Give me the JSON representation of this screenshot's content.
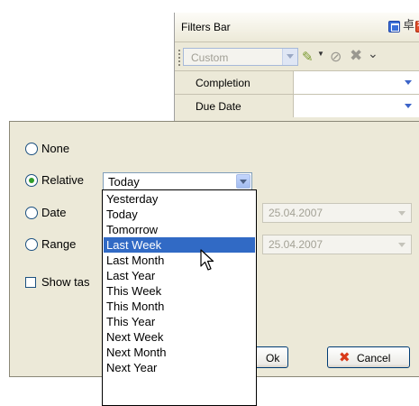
{
  "panel": {
    "title": "Filters Bar",
    "toolbar": {
      "preset_value": "Custom"
    },
    "rows": [
      {
        "label": "Completion"
      },
      {
        "label": "Due Date"
      }
    ]
  },
  "dialog": {
    "options": [
      {
        "label": "None",
        "selected": false
      },
      {
        "label": "Relative",
        "selected": true
      },
      {
        "label": "Date",
        "selected": false
      },
      {
        "label": "Range",
        "selected": false
      }
    ],
    "relative_value": "Today",
    "date_value": "25.04.2007",
    "range_value": "25.04.2007",
    "show_tasks_label": "Show tas",
    "ok_label": "Ok",
    "cancel_label": "Cancel"
  },
  "dropdown": {
    "items": [
      "Yesterday",
      "Today",
      "Tomorrow",
      "Last Week",
      "Last Month",
      "Last Year",
      "This Week",
      "This Month",
      "This Year",
      "Next Week",
      "Next Month",
      "Next Year"
    ],
    "selected": "Last Week"
  },
  "colors": {
    "selection": "#316ac5",
    "dialog_background": "#ece9d8"
  }
}
